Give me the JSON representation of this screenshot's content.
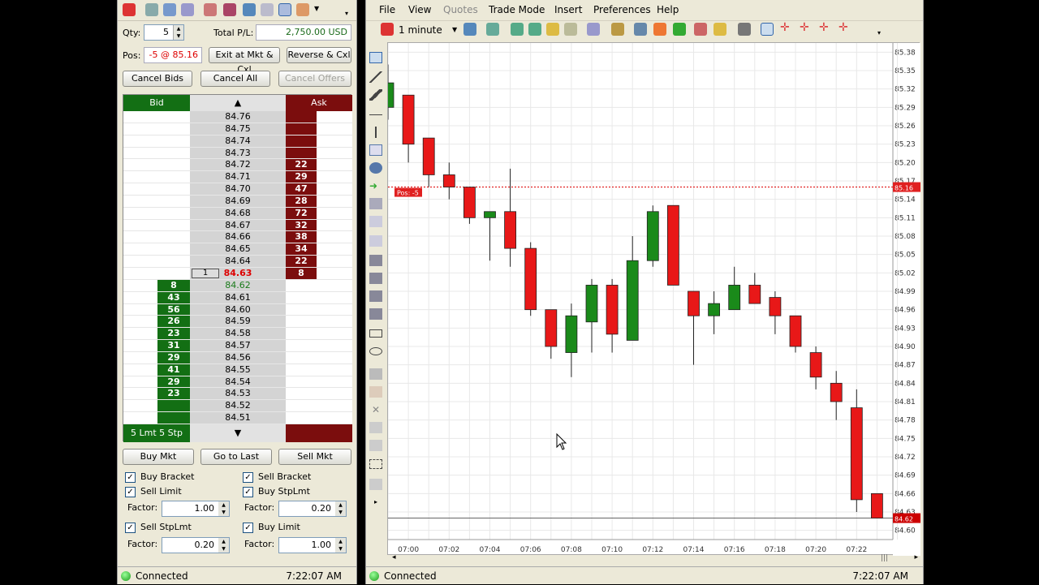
{
  "dom": {
    "qty_label": "Qty:",
    "qty_value": "5",
    "total_pl_label": "Total P/L:",
    "total_pl_value": "2,750.00 USD",
    "pos_label": "Pos:",
    "pos_value": "-5 @ 85.16",
    "buttons": {
      "exit": "Exit at Mkt & Cxl",
      "reverse": "Reverse & Cxl",
      "cancel_bids": "Cancel Bids",
      "cancel_all": "Cancel All",
      "cancel_offers": "Cancel Offers",
      "buy_mkt": "Buy Mkt",
      "go_to_last": "Go to Last",
      "sell_mkt": "Sell Mkt"
    },
    "bid_header": "Bid",
    "ask_header": "Ask",
    "footer_left": "5 Lmt 5 Stp",
    "ladder": [
      {
        "price": "84.76",
        "bid": "",
        "ask": "",
        "my": ""
      },
      {
        "price": "84.75",
        "bid": "",
        "ask": "",
        "my": ""
      },
      {
        "price": "84.74",
        "bid": "",
        "ask": "",
        "my": ""
      },
      {
        "price": "84.73",
        "bid": "",
        "ask": "",
        "my": ""
      },
      {
        "price": "84.72",
        "bid": "",
        "ask": "22",
        "my": ""
      },
      {
        "price": "84.71",
        "bid": "",
        "ask": "29",
        "my": ""
      },
      {
        "price": "84.70",
        "bid": "",
        "ask": "47",
        "my": ""
      },
      {
        "price": "84.69",
        "bid": "",
        "ask": "28",
        "my": ""
      },
      {
        "price": "84.68",
        "bid": "",
        "ask": "72",
        "my": ""
      },
      {
        "price": "84.67",
        "bid": "",
        "ask": "32",
        "my": ""
      },
      {
        "price": "84.66",
        "bid": "",
        "ask": "38",
        "my": ""
      },
      {
        "price": "84.65",
        "bid": "",
        "ask": "34",
        "my": ""
      },
      {
        "price": "84.64",
        "bid": "",
        "ask": "22",
        "my": ""
      },
      {
        "price": "84.63",
        "bid": "",
        "ask": "8",
        "my": "1"
      },
      {
        "price": "84.62",
        "bid": "8",
        "ask": "",
        "my": ""
      },
      {
        "price": "84.61",
        "bid": "43",
        "ask": "",
        "my": ""
      },
      {
        "price": "84.60",
        "bid": "56",
        "ask": "",
        "my": ""
      },
      {
        "price": "84.59",
        "bid": "26",
        "ask": "",
        "my": ""
      },
      {
        "price": "84.58",
        "bid": "23",
        "ask": "",
        "my": ""
      },
      {
        "price": "84.57",
        "bid": "31",
        "ask": "",
        "my": ""
      },
      {
        "price": "84.56",
        "bid": "29",
        "ask": "",
        "my": ""
      },
      {
        "price": "84.55",
        "bid": "41",
        "ask": "",
        "my": ""
      },
      {
        "price": "84.54",
        "bid": "29",
        "ask": "",
        "my": ""
      },
      {
        "price": "84.53",
        "bid": "23",
        "ask": "",
        "my": ""
      },
      {
        "price": "84.52",
        "bid": "",
        "ask": "",
        "my": ""
      },
      {
        "price": "84.51",
        "bid": "",
        "ask": "",
        "my": ""
      }
    ],
    "atm": {
      "sell_bracket": "Sell Bracket",
      "buy_bracket": "Buy Bracket",
      "sell_limit": "Sell Limit",
      "buy_stplmt": "Buy StpLmt",
      "sell_stplmt": "Sell StpLmt",
      "buy_limit": "Buy Limit",
      "factor_label": "Factor:",
      "f1": "1.00",
      "f2": "0.20",
      "f3": "0.20",
      "f4": "1.00"
    },
    "status": "Connected",
    "time": "7:22:07 AM"
  },
  "chart": {
    "menu": [
      "File",
      "View",
      "Quotes",
      "Trade Mode",
      "Insert",
      "Preferences",
      "Help"
    ],
    "interval": "1 minute",
    "pos_tag": "Pos: -5",
    "pos_price_tag": "85.16",
    "last_price_tag": "84.62",
    "status": "Connected",
    "time": "7:22:07 AM"
  },
  "chart_data": {
    "type": "candlestick",
    "ylim": [
      84.585,
      85.395
    ],
    "price_ticks": [
      "85.38",
      "85.35",
      "85.32",
      "85.29",
      "85.26",
      "85.23",
      "85.20",
      "85.17",
      "85.14",
      "85.11",
      "85.08",
      "85.05",
      "85.02",
      "84.99",
      "84.96",
      "84.93",
      "84.90",
      "84.87",
      "84.84",
      "84.81",
      "84.78",
      "84.75",
      "84.72",
      "84.69",
      "84.66",
      "84.63",
      "84.60"
    ],
    "time_ticks": [
      "07:00",
      "07:02",
      "07:04",
      "07:06",
      "07:08",
      "07:10",
      "07:12",
      "07:14",
      "07:16",
      "07:18",
      "07:20",
      "07:22"
    ],
    "position_price": 85.16,
    "last_price": 84.62,
    "candles": [
      {
        "t": "06:59",
        "o": 85.29,
        "h": 85.36,
        "l": 85.27,
        "c": 85.33
      },
      {
        "t": "07:00",
        "o": 85.31,
        "h": 85.31,
        "l": 85.2,
        "c": 85.23
      },
      {
        "t": "07:01",
        "o": 85.24,
        "h": 85.24,
        "l": 85.16,
        "c": 85.18
      },
      {
        "t": "07:02",
        "o": 85.18,
        "h": 85.2,
        "l": 85.14,
        "c": 85.16
      },
      {
        "t": "07:03",
        "o": 85.16,
        "h": 85.16,
        "l": 85.1,
        "c": 85.11
      },
      {
        "t": "07:04",
        "o": 85.11,
        "h": 85.12,
        "l": 85.04,
        "c": 85.12
      },
      {
        "t": "07:05",
        "o": 85.12,
        "h": 85.19,
        "l": 85.03,
        "c": 85.06
      },
      {
        "t": "07:06",
        "o": 85.06,
        "h": 85.07,
        "l": 84.95,
        "c": 84.96
      },
      {
        "t": "07:07",
        "o": 84.96,
        "h": 84.96,
        "l": 84.88,
        "c": 84.9
      },
      {
        "t": "07:08",
        "o": 84.89,
        "h": 84.97,
        "l": 84.85,
        "c": 84.95
      },
      {
        "t": "07:09",
        "o": 84.94,
        "h": 85.01,
        "l": 84.89,
        "c": 85.0
      },
      {
        "t": "07:10",
        "o": 85.0,
        "h": 85.01,
        "l": 84.89,
        "c": 84.92
      },
      {
        "t": "07:11",
        "o": 84.91,
        "h": 85.08,
        "l": 84.91,
        "c": 85.04
      },
      {
        "t": "07:12",
        "o": 85.04,
        "h": 85.13,
        "l": 85.03,
        "c": 85.12
      },
      {
        "t": "07:13",
        "o": 85.13,
        "h": 85.13,
        "l": 85.0,
        "c": 85.0
      },
      {
        "t": "07:14",
        "o": 84.99,
        "h": 84.99,
        "l": 84.87,
        "c": 84.95
      },
      {
        "t": "07:15",
        "o": 84.95,
        "h": 84.99,
        "l": 84.92,
        "c": 84.97
      },
      {
        "t": "07:16",
        "o": 84.96,
        "h": 85.03,
        "l": 84.96,
        "c": 85.0
      },
      {
        "t": "07:17",
        "o": 85.0,
        "h": 85.02,
        "l": 84.97,
        "c": 84.97
      },
      {
        "t": "07:18",
        "o": 84.98,
        "h": 84.99,
        "l": 84.92,
        "c": 84.95
      },
      {
        "t": "07:19",
        "o": 84.95,
        "h": 84.95,
        "l": 84.89,
        "c": 84.9
      },
      {
        "t": "07:20",
        "o": 84.89,
        "h": 84.9,
        "l": 84.83,
        "c": 84.85
      },
      {
        "t": "07:21",
        "o": 84.84,
        "h": 84.86,
        "l": 84.78,
        "c": 84.81
      },
      {
        "t": "07:22",
        "o": 84.8,
        "h": 84.83,
        "l": 84.63,
        "c": 84.65
      },
      {
        "t": "07:23",
        "o": 84.66,
        "h": 84.66,
        "l": 84.62,
        "c": 84.62
      }
    ]
  }
}
